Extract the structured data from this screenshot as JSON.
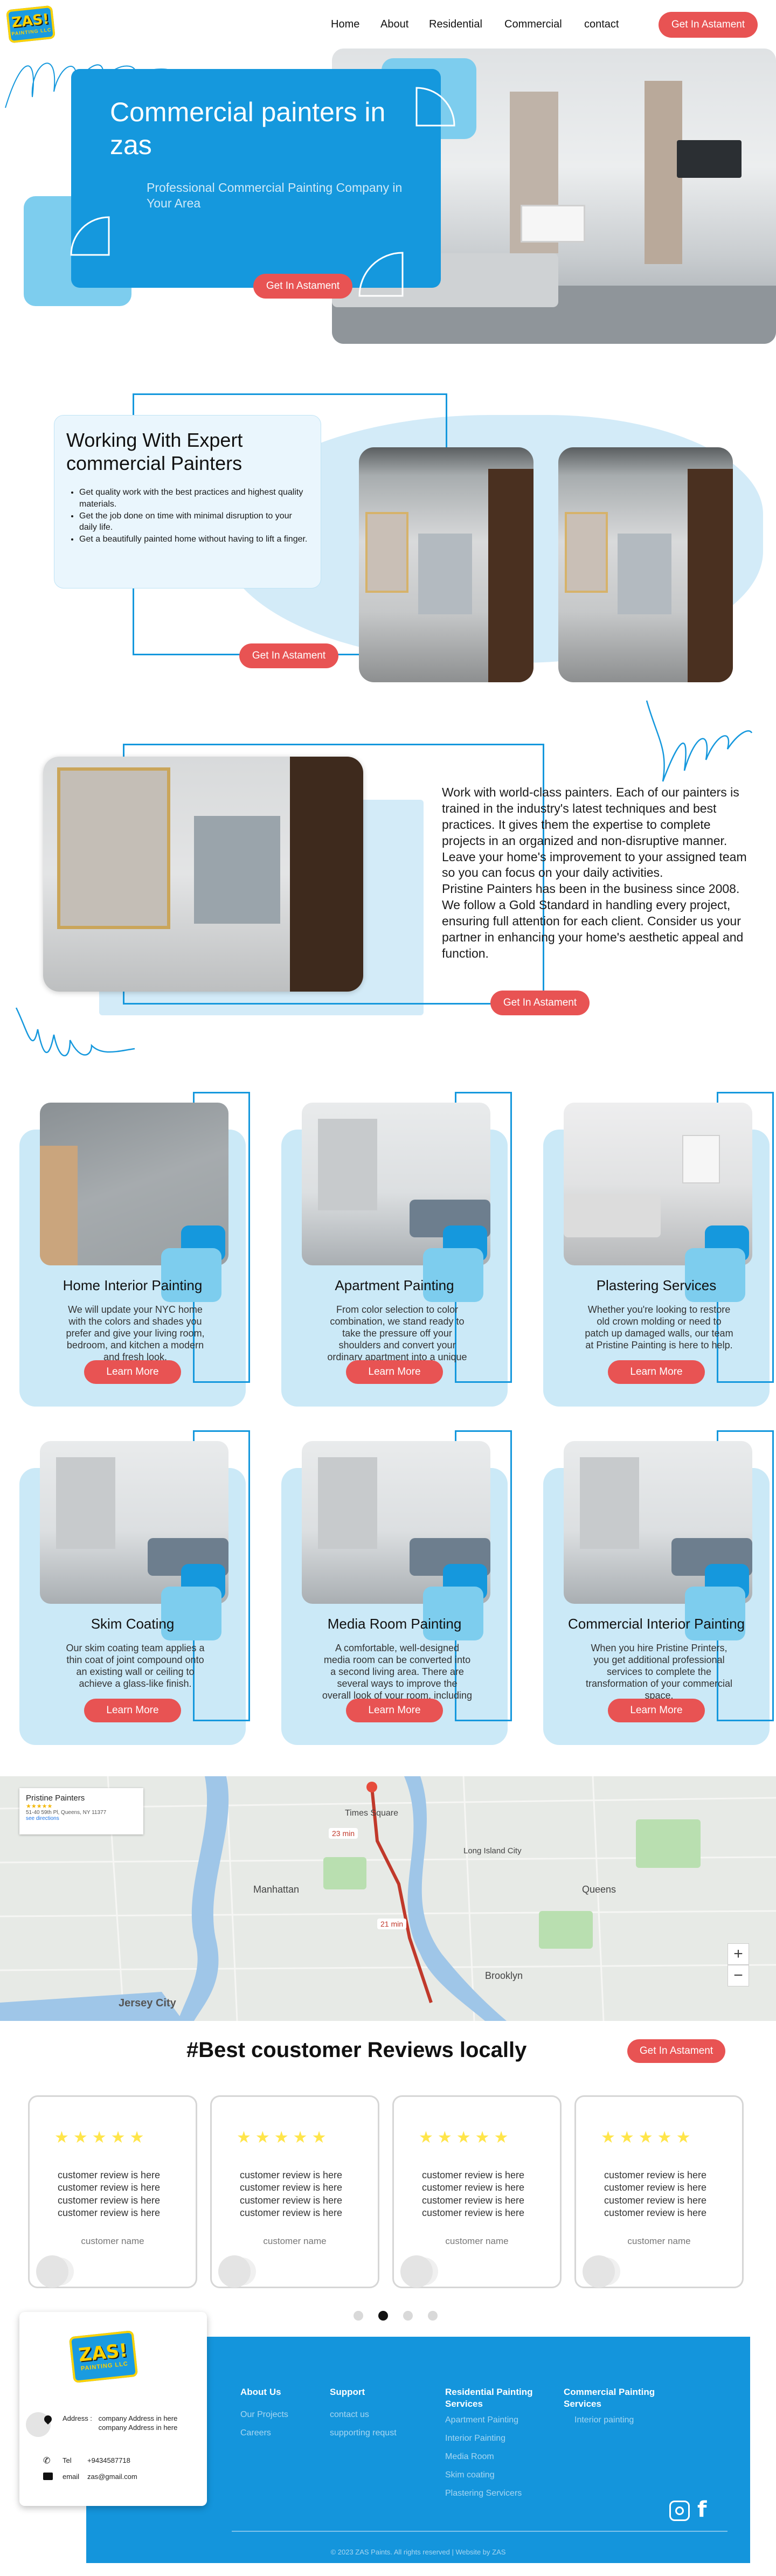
{
  "brand": {
    "logo_text": "ZAS!",
    "logo_sub": "PAINTING LLC"
  },
  "nav": {
    "items": [
      {
        "label": "Home"
      },
      {
        "label": "About"
      },
      {
        "label": "Residential"
      },
      {
        "label": "Commercial"
      },
      {
        "label": "contact"
      }
    ],
    "cta": "Get In Astament"
  },
  "hero": {
    "title": "Commercial painters in zas",
    "subtitle": "Professional Commercial Painting Company in Your Area",
    "cta": "Get In Astament"
  },
  "expert": {
    "title": "Working With Expert commercial Painters",
    "bullets": [
      "Get quality work with the best practices and highest quality materials.",
      "Get the job done on time with minimal disruption to your daily life.",
      "Get a beautifully painted home without having to lift a finger."
    ],
    "cta": "Get In Astament"
  },
  "about": {
    "paragraph": "Work with world-class painters. Each of our painters is trained in the industry's latest techniques and best practices. It gives them the expertise to complete projects in an organized and non-disruptive manner. Leave your home's improvement to your assigned team so you can focus on your daily activities.\nPristine Painters has been in the business since 2008. We follow a Gold Standard in handling every project, ensuring full attention for each client. Consider us your partner in enhancing your home's aesthetic appeal and function.",
    "cta": "Get In Astament"
  },
  "services": [
    {
      "title": "Home Interior Painting",
      "desc": "We will update your NYC home with the colors and shades you prefer and give your living room, bedroom, and kitchen a modern and fresh look.",
      "cta": "Learn More"
    },
    {
      "title": "Apartment Painting",
      "desc": "From color selection to color combination, we stand ready to take the pressure off your shoulders and convert your ordinary apartment into a unique space to enjoy.",
      "cta": "Learn More"
    },
    {
      "title": "Plastering Services",
      "desc": "Whether you're looking to restore old crown molding or need to patch up damaged walls, our team at Pristine Painting is here to help.",
      "cta": "Learn More"
    },
    {
      "title": "Skim Coating",
      "desc": "Our skim coating team applies a thin coat of joint compound onto an existing wall or ceiling to achieve a glass-like finish.",
      "cta": "Learn More"
    },
    {
      "title": "Media Room Painting",
      "desc": "A comfortable, well-designed media room can be converted into a second living area. There are several ways to improve the overall look of your room, including painting the walls.",
      "cta": "Learn More"
    },
    {
      "title": "Commercial Interior Painting",
      "desc": "When you hire Pristine Printers, you get additional professional services to complete the transformation of your commercial space.",
      "cta": "Learn More"
    }
  ],
  "map": {
    "place_name": "Pristine Painters",
    "rating_stars": "★★★★★",
    "address": "51-40 59th Pl, Queens, NY 11377",
    "link": "see directions",
    "labels": [
      "Jersey City",
      "Times Square",
      "Manhattan",
      "Queens",
      "23 min",
      "21 min",
      "Brooklyn",
      "Long Island City"
    ],
    "zoom_in": "+",
    "zoom_out": "−"
  },
  "reviews": {
    "title": "#Best coustomer Reviews locally",
    "cta": "Get In Astament",
    "stars": "★★★★★",
    "items": [
      {
        "lines": [
          "customer review is here",
          "customer review is here",
          "customer review is here",
          "customer review is here"
        ],
        "name": "customer name"
      },
      {
        "lines": [
          "customer review is here",
          "customer review is here",
          "customer review is here",
          "customer review is here"
        ],
        "name": "customer name"
      },
      {
        "lines": [
          "customer review is here",
          "customer review is here",
          "customer review is here",
          "customer review is here"
        ],
        "name": "customer name"
      },
      {
        "lines": [
          "customer review is here",
          "customer review is here",
          "customer review is here",
          "customer review is here"
        ],
        "name": "customer name"
      }
    ],
    "dots_active": 2
  },
  "footer": {
    "address_label": "Address :",
    "address_value": "company Address in here company Address in here",
    "tel_label": "Tel",
    "tel_value": "+9434587718",
    "email_label": "email",
    "email_value": "zas@gmail.com",
    "cols": [
      {
        "title": "About Us",
        "links": [
          "Our Projects",
          "Careers"
        ]
      },
      {
        "title": "Support",
        "links": [
          "contact us",
          "supporting requst"
        ]
      },
      {
        "title": "Residential Painting Services",
        "links": [
          "Apartment Painting",
          "Interior Painting",
          "Media Room",
          "Skim coating",
          "Plastering Servicers"
        ]
      },
      {
        "title": "Commercial Painting Services",
        "links": [
          "Interior painting"
        ]
      }
    ],
    "copyright": "© 2023 ZAS Paints. All rights reserved | Website by ZAS"
  },
  "colors": {
    "primary": "#1598dd",
    "light": "#7dcdee",
    "accent": "#e85353",
    "star": "#ffe54a"
  }
}
